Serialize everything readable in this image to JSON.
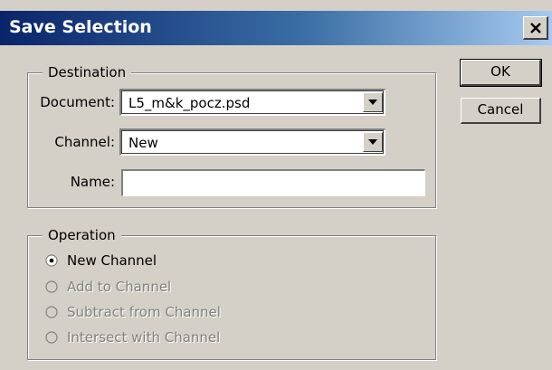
{
  "dialog": {
    "title": "Save Selection"
  },
  "destination": {
    "group_label": "Destination",
    "document_label": "Document:",
    "document_value": "L5_m&k_pocz.psd",
    "channel_label": "Channel:",
    "channel_value": "New",
    "name_label": "Name:",
    "name_value": ""
  },
  "operation": {
    "group_label": "Operation",
    "options": [
      {
        "label": "New Channel",
        "selected": true,
        "enabled": true
      },
      {
        "label": "Add to Channel",
        "selected": false,
        "enabled": false
      },
      {
        "label": "Subtract from Channel",
        "selected": false,
        "enabled": false
      },
      {
        "label": "Intersect with Channel",
        "selected": false,
        "enabled": false
      }
    ]
  },
  "buttons": {
    "ok_label": "OK",
    "cancel_label": "Cancel"
  },
  "colors": {
    "title_gradient_start": "#0a246a",
    "title_gradient_end": "#a6caf0",
    "dialog_face": "#d4d0c8",
    "disabled_text": "#808080"
  }
}
